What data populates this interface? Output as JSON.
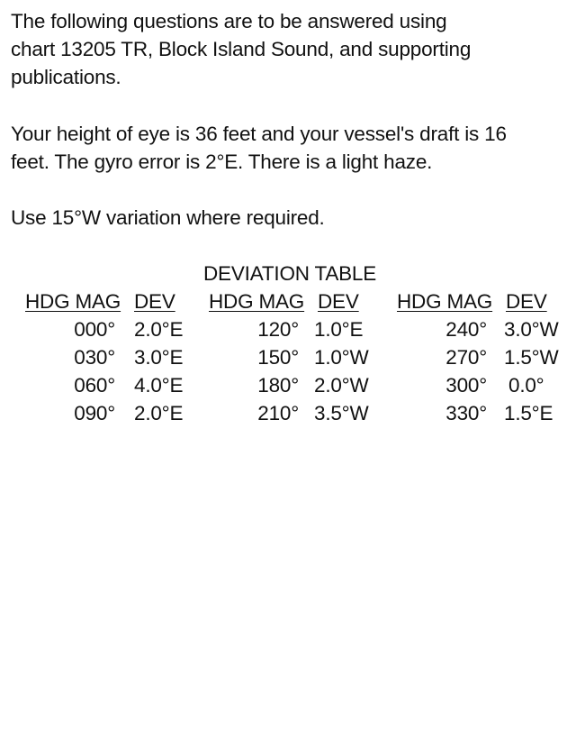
{
  "intro": {
    "paragraph1": "The following questions are to be answered using\nchart 13205 TR, Block Island Sound, and supporting\npublications.",
    "paragraph2": "Your height of eye is 36 feet and your vessel's draft is 16\nfeet. The gyro error is 2°E. There is a light haze.",
    "paragraph3": "Use 15°W variation where required."
  },
  "deviation_table": {
    "title": "DEVIATION TABLE",
    "header_hdg": "HDG MAG",
    "header_dev": "DEV",
    "groups": [
      {
        "rows": [
          {
            "hdg": "000°",
            "dev": "2.0°E"
          },
          {
            "hdg": "030°",
            "dev": "3.0°E"
          },
          {
            "hdg": "060°",
            "dev": "4.0°E"
          },
          {
            "hdg": "090°",
            "dev": "2.0°E"
          }
        ]
      },
      {
        "rows": [
          {
            "hdg": "120°",
            "dev": "1.0°E"
          },
          {
            "hdg": "150°",
            "dev": "1.0°W"
          },
          {
            "hdg": "180°",
            "dev": "2.0°W"
          },
          {
            "hdg": "210°",
            "dev": "3.5°W"
          }
        ]
      },
      {
        "rows": [
          {
            "hdg": "240°",
            "dev": "3.0°W"
          },
          {
            "hdg": "270°",
            "dev": "1.5°W"
          },
          {
            "hdg": "300°",
            "dev": "0.0°"
          },
          {
            "hdg": "330°",
            "dev": "1.5°E"
          }
        ]
      }
    ]
  }
}
